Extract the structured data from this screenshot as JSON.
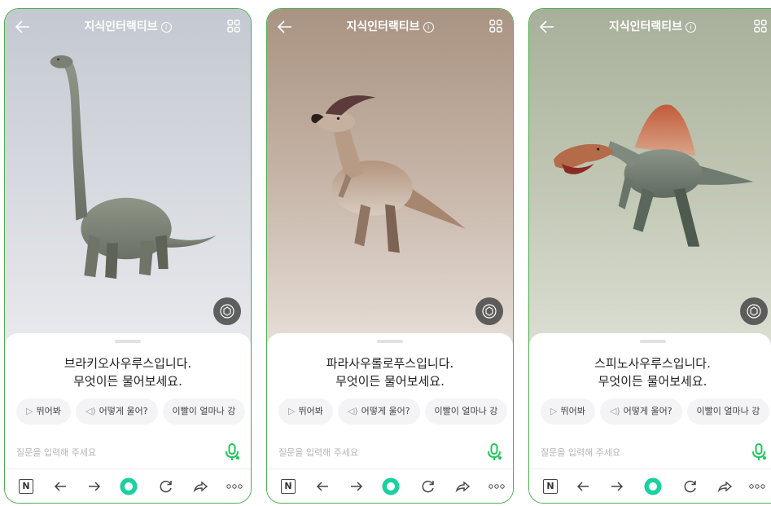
{
  "app": {
    "title": "지식인터랙티브",
    "info_glyph": "i"
  },
  "panels": [
    {
      "species": "brachiosaurus",
      "message_line1": "브라키오사우루스입니다.",
      "message_line2": "무엇이든 물어보세요.",
      "chips": [
        "뛰어봐",
        "어떻게 울어?",
        "이빨이 얼마나 강"
      ],
      "input_placeholder": "질문을 입력해 주세요",
      "bg_color": "#cfd3da"
    },
    {
      "species": "parasaurolophus",
      "message_line1": "파라사우롤로푸스입니다.",
      "message_line2": "무엇이든 물어보세요.",
      "chips": [
        "뛰어봐",
        "어떻게 울어?",
        "이빨이 얼마나 강"
      ],
      "input_placeholder": "질문을 입력해 주세요",
      "bg_color": "#c3b1a3"
    },
    {
      "species": "spinosaurus",
      "message_line1": "스피노사우루스입니다.",
      "message_line2": "무엇이든 물어보세요.",
      "chips": [
        "뛰어봐",
        "어떻게 울어?",
        "이빨이 얼마나 강"
      ],
      "input_placeholder": "질문을 입력해 주세요",
      "bg_color": "#c0c6b3"
    }
  ],
  "navbar": {
    "n_label": "N",
    "icons": [
      "n-icon",
      "back-arrow-icon",
      "forward-arrow-icon",
      "green-circle-icon",
      "refresh-icon",
      "share-icon",
      "more-icon"
    ]
  },
  "colors": {
    "accent_green": "#19d2a0",
    "mic_green": "#1ec85a",
    "frame_green": "#4cae4c"
  }
}
